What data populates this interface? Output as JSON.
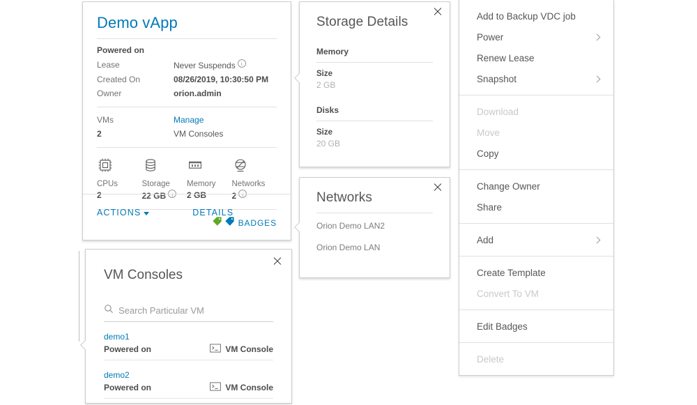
{
  "vapp": {
    "title": "Demo vApp",
    "status": "Powered on",
    "details": [
      {
        "key": "Lease",
        "value": "Never Suspends",
        "info": true,
        "style": "plain"
      },
      {
        "key": "Created On",
        "value": "08/26/2019, 10:30:50 PM",
        "info": false,
        "style": "bold"
      },
      {
        "key": "Owner",
        "value": "orion.admin",
        "info": false,
        "style": "bold"
      }
    ],
    "vms": {
      "key": "VMs",
      "value": "2",
      "manage_label": "Manage",
      "manage_target": "VM Consoles"
    },
    "resources": [
      {
        "icon": "cpu-icon",
        "label": "CPUs",
        "value": "2",
        "info": false
      },
      {
        "icon": "storage-icon",
        "label": "Storage",
        "value": "22 GB",
        "info": true
      },
      {
        "icon": "memory-icon",
        "label": "Memory",
        "value": "2 GB",
        "info": false
      },
      {
        "icon": "network-icon",
        "label": "Networks",
        "value": "2",
        "info": true
      }
    ],
    "badges": {
      "label": "BADGES",
      "green_color": "#5eaa22",
      "blue_color": "#0079b8"
    },
    "footer": {
      "actions_label": "ACTIONS",
      "details_label": "DETAILS"
    },
    "accent_color": "#0079b8"
  },
  "storage_details": {
    "title": "Storage Details",
    "groups": [
      {
        "name": "Memory",
        "field_label": "Size",
        "field_value": "2 GB"
      },
      {
        "name": "Disks",
        "field_label": "Size",
        "field_value": "20 GB"
      }
    ]
  },
  "networks": {
    "title": "Networks",
    "items": [
      {
        "name": "Orion Demo LAN2"
      },
      {
        "name": "Orion Demo LAN"
      }
    ]
  },
  "vm_consoles": {
    "title": "VM Consoles",
    "search": {
      "placeholder": "Search Particular VM",
      "value": ""
    },
    "rows": [
      {
        "name": "demo1",
        "state": "Powered on",
        "console_label": "VM Console"
      },
      {
        "name": "demo2",
        "state": "Powered on",
        "console_label": "VM Console"
      }
    ]
  },
  "actions_menu": {
    "groups": [
      {
        "items": [
          {
            "label": "Add to Backup VDC job",
            "disabled": false,
            "submenu": false
          },
          {
            "label": "Power",
            "disabled": false,
            "submenu": true
          },
          {
            "label": "Renew Lease",
            "disabled": false,
            "submenu": false
          },
          {
            "label": "Snapshot",
            "disabled": false,
            "submenu": true
          }
        ]
      },
      {
        "items": [
          {
            "label": "Download",
            "disabled": true,
            "submenu": false
          },
          {
            "label": "Move",
            "disabled": true,
            "submenu": false
          },
          {
            "label": "Copy",
            "disabled": false,
            "submenu": false
          }
        ]
      },
      {
        "items": [
          {
            "label": "Change Owner",
            "disabled": false,
            "submenu": false
          },
          {
            "label": "Share",
            "disabled": false,
            "submenu": false
          }
        ]
      },
      {
        "items": [
          {
            "label": "Add",
            "disabled": false,
            "submenu": true
          }
        ]
      },
      {
        "items": [
          {
            "label": "Create Template",
            "disabled": false,
            "submenu": false
          },
          {
            "label": "Convert To VM",
            "disabled": true,
            "submenu": false
          }
        ]
      },
      {
        "items": [
          {
            "label": "Edit Badges",
            "disabled": false,
            "submenu": false
          }
        ]
      },
      {
        "items": [
          {
            "label": "Delete",
            "disabled": true,
            "submenu": false
          }
        ]
      }
    ]
  }
}
